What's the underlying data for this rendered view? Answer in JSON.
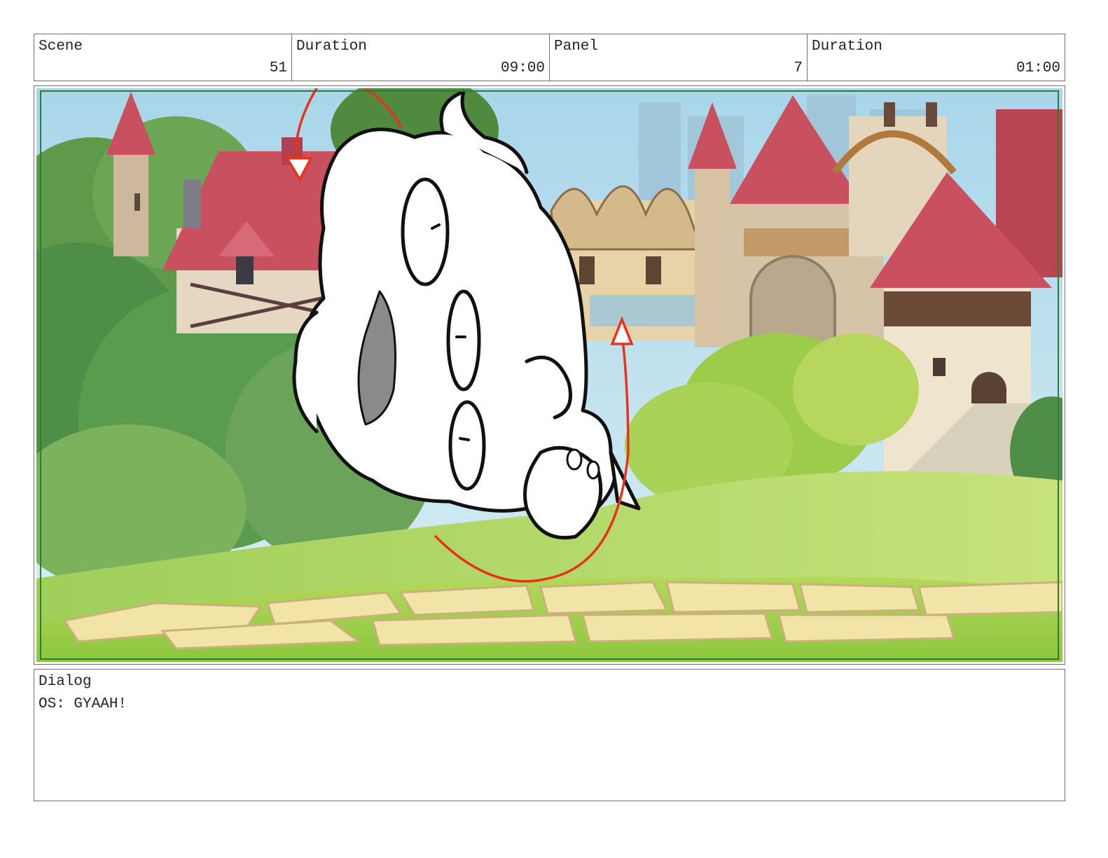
{
  "header": {
    "scene_label": "Scene",
    "scene_value": "51",
    "scene_duration_label": "Duration",
    "scene_duration_value": "09:00",
    "panel_label": "Panel",
    "panel_value": "7",
    "panel_duration_label": "Duration",
    "panel_duration_value": "01:00"
  },
  "dialog": {
    "label": "Dialog",
    "text": "OS: GYAAH!"
  },
  "colors": {
    "border": "#6f6f6f",
    "safe_frame": "#2e7d32",
    "motion_arrow": "#e8321c",
    "roof": "#c9505e",
    "grass": "#9ccc4a",
    "sky": "#b7dcec"
  }
}
